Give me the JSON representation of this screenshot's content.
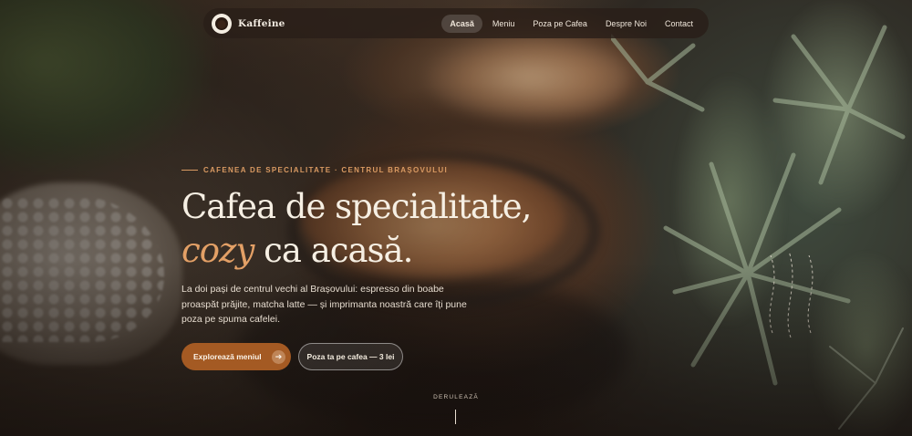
{
  "nav": {
    "brand": "Kaffeine",
    "links": [
      {
        "label": "Acasă",
        "active": true
      },
      {
        "label": "Meniu",
        "active": false
      },
      {
        "label": "Poza pe Cafea",
        "active": false
      },
      {
        "label": "Despre Noi",
        "active": false
      },
      {
        "label": "Contact",
        "active": false
      }
    ]
  },
  "hero": {
    "eyebrow": "CAFENEA DE SPECIALITATE · CENTRUL BRAȘOVULUI",
    "headline_line1": "Cafea de specialitate,",
    "headline_accent": "cozy",
    "headline_rest": "ca acasă.",
    "lede": "La doi pași de centrul vechi al Brașovului: espresso din boabe proaspăt prăjite, matcha latte — și imprimanta noastră care îți pune poza pe spuma cafelei.",
    "primary_cta": "Explorează meniul",
    "secondary_cta": "Poza ta pe cafea — 3 lei",
    "scroll_hint": "DERULEAZĂ"
  },
  "icons": {
    "logo": "coffee-cup-logo-icon",
    "cta_arrow": "arrow-right-icon"
  },
  "colors": {
    "accent": "#a45a23",
    "accent_text": "#e3a066",
    "eyebrow": "#d99a62",
    "nav_bg": "#2a1e18"
  }
}
